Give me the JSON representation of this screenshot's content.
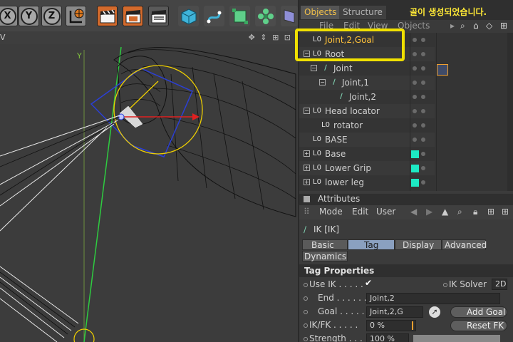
{
  "toolbar": {
    "axis_buttons": [
      "X",
      "Y",
      "Z"
    ]
  },
  "viewport": {
    "label": "V",
    "nav": "✥ ⇕ ⊞ ⊡"
  },
  "caption": "골이 생성되었습니다.",
  "tabs": [
    {
      "label": "Objects",
      "active": true
    },
    {
      "label": "Structure",
      "active": false
    }
  ],
  "objects_menu": [
    "File",
    "Edit",
    "View",
    "Objects"
  ],
  "tree": [
    {
      "label": "Joint,2,Goal",
      "indent": 0
    },
    {
      "label": "Root",
      "indent": 0
    },
    {
      "label": "Joint",
      "indent": 1
    },
    {
      "label": "Joint,1",
      "indent": 2
    },
    {
      "label": "Joint,2",
      "indent": 3
    },
    {
      "label": "Head locator",
      "indent": 0
    },
    {
      "label": "rotator",
      "indent": 1
    },
    {
      "label": "BASE",
      "indent": 0
    },
    {
      "label": "Base",
      "indent": 0
    },
    {
      "label": "Lower Grip",
      "indent": 0
    },
    {
      "label": "lower leg",
      "indent": 0
    }
  ],
  "attributes": {
    "header": "Attributes",
    "menu": [
      "Mode",
      "Edit",
      "User"
    ],
    "title": "IK [IK]",
    "tabs": [
      "Basic",
      "Tag",
      "Display",
      "Advanced",
      "Dynamics"
    ],
    "active_tab": "Tag",
    "section": "Tag Properties",
    "use_ik_label": "Use IK . . . . .",
    "use_ik_check": "✔",
    "ik_solver_label": "IK Solver",
    "ik_solver_value": "2D",
    "end_label": "End . . . . . .",
    "end_value": "Joint,2",
    "goal_label": "Goal . . . . .",
    "goal_value": "Joint,2,G",
    "add_goal": "Add Goal",
    "ikfk_label": "IK/FK . . . . .",
    "ikfk_value": "0 %",
    "reset_fk": "Reset FK",
    "strength_label": "Strength . . .",
    "strength_value": "100 %"
  },
  "colors": {
    "accent_orange": "#d36a2c",
    "highlight_yellow": "#f0e000",
    "tag_cyan": "#1de9c4"
  }
}
